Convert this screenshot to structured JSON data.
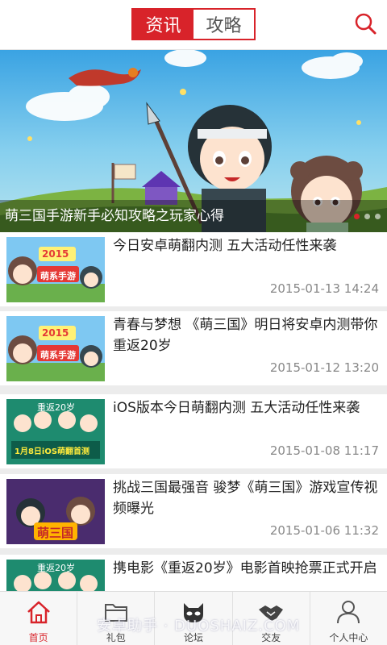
{
  "header": {
    "tabs": [
      {
        "label": "资讯",
        "active": true
      },
      {
        "label": "攻略",
        "active": false
      }
    ],
    "search_icon": "search-icon",
    "accent_color": "#d8232a"
  },
  "banner": {
    "caption": "萌三国手游新手必知攻略之玩家心得",
    "slide_count": 3,
    "active_slide": 1
  },
  "news": [
    {
      "title": "今日安卓萌翻内测 五大活动任性来袭",
      "date": "2015-01-13 14:24",
      "thumb_badge": "2015",
      "thumb_text": "萌系手游"
    },
    {
      "title": "青春与梦想 《萌三国》明日将安卓内测带你重返20岁",
      "date": "2015-01-12 13:20",
      "thumb_badge": "2015",
      "thumb_text": "萌系手游"
    },
    {
      "title": "iOS版本今日萌翻内测 五大活动任性来袭",
      "date": "2015-01-08 11:17",
      "thumb_badge": "重返20岁",
      "thumb_text": "1月8日iOS萌翻首测"
    },
    {
      "title": "挑战三国最强音 骏梦《萌三国》游戏宣传视频曝光",
      "date": "2015-01-06 11:32",
      "thumb_badge": "",
      "thumb_text": "萌三国"
    },
    {
      "title": "携电影《重返20岁》电影首映抢票正式开启",
      "date": "",
      "thumb_badge": "重返20岁",
      "thumb_text": ""
    }
  ],
  "tabbar": [
    {
      "label": "首页",
      "icon": "home-icon",
      "active": true
    },
    {
      "label": "礼包",
      "icon": "folder-icon",
      "active": false
    },
    {
      "label": "论坛",
      "icon": "forum-mask-icon",
      "active": false
    },
    {
      "label": "交友",
      "icon": "handshake-icon",
      "active": false
    },
    {
      "label": "个人中心",
      "icon": "user-icon",
      "active": false
    }
  ],
  "watermark": "安卓助手 · DUOSHAIZ.COM"
}
